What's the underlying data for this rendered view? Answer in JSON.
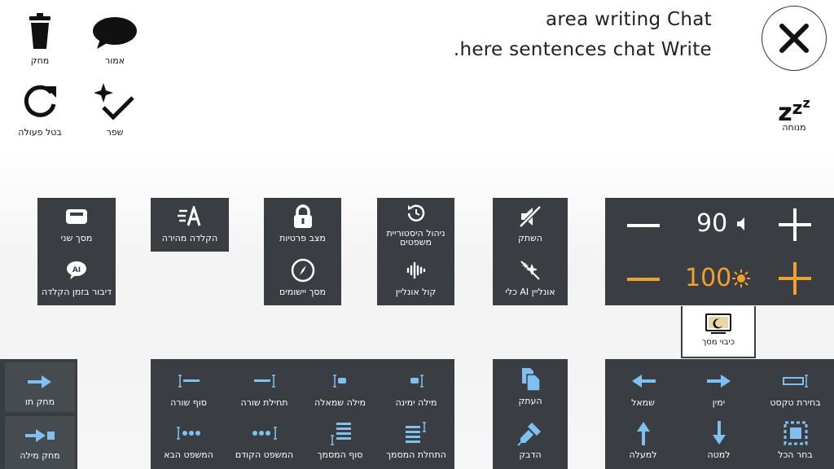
{
  "toolbar": {
    "delete_label": "מחק",
    "say_label": "אמור",
    "undo_label": "בטל פעולה",
    "improve_label": "שפר",
    "rest_label": "מנוחה"
  },
  "chat": {
    "title": "area writing Chat",
    "placeholder": ".here sentences chat Write"
  },
  "settings_panels": {
    "second_screen": "מסך שני",
    "speech_while_typing": "דיבור בזמן הקלדה",
    "fast_typing": "הקלדה מהירה",
    "privacy_mode": "מצב פרטיות",
    "apps_screen": "מסך יישומים",
    "sentence_history": "ניהול היסטוריית משפטים",
    "online_voice": "קול אונליין",
    "mute": "השתק",
    "online_ai_tools": "כלי AI אונליין"
  },
  "volume_brightness": {
    "volume_value": "90",
    "brightness_value": "100",
    "accent_color": "#f0a030"
  },
  "screen_saver": {
    "label": "כיבוי מסך"
  },
  "delete_panel": {
    "delete_char": "מחק תו",
    "delete_word": "מחק מילה"
  },
  "navigation_panel": {
    "line_end": "סוף שורה",
    "line_start": "תחילת שורה",
    "word_left": "מילה שמאלה",
    "word_right": "מילה ימינה",
    "next_sentence": "המשפט הבא",
    "prev_sentence": "המשפט הקודם",
    "doc_end": "סוף המסמך",
    "doc_start": "התחלת המסמך"
  },
  "clipboard_panel": {
    "copy": "העתק",
    "paste": "הדבק"
  },
  "selection_panel": {
    "left": "שמאל",
    "right": "ימין",
    "select_text": "בחירת טקסט",
    "up": "למעלה",
    "down": "למטה",
    "select_all": "בחר הכל"
  }
}
